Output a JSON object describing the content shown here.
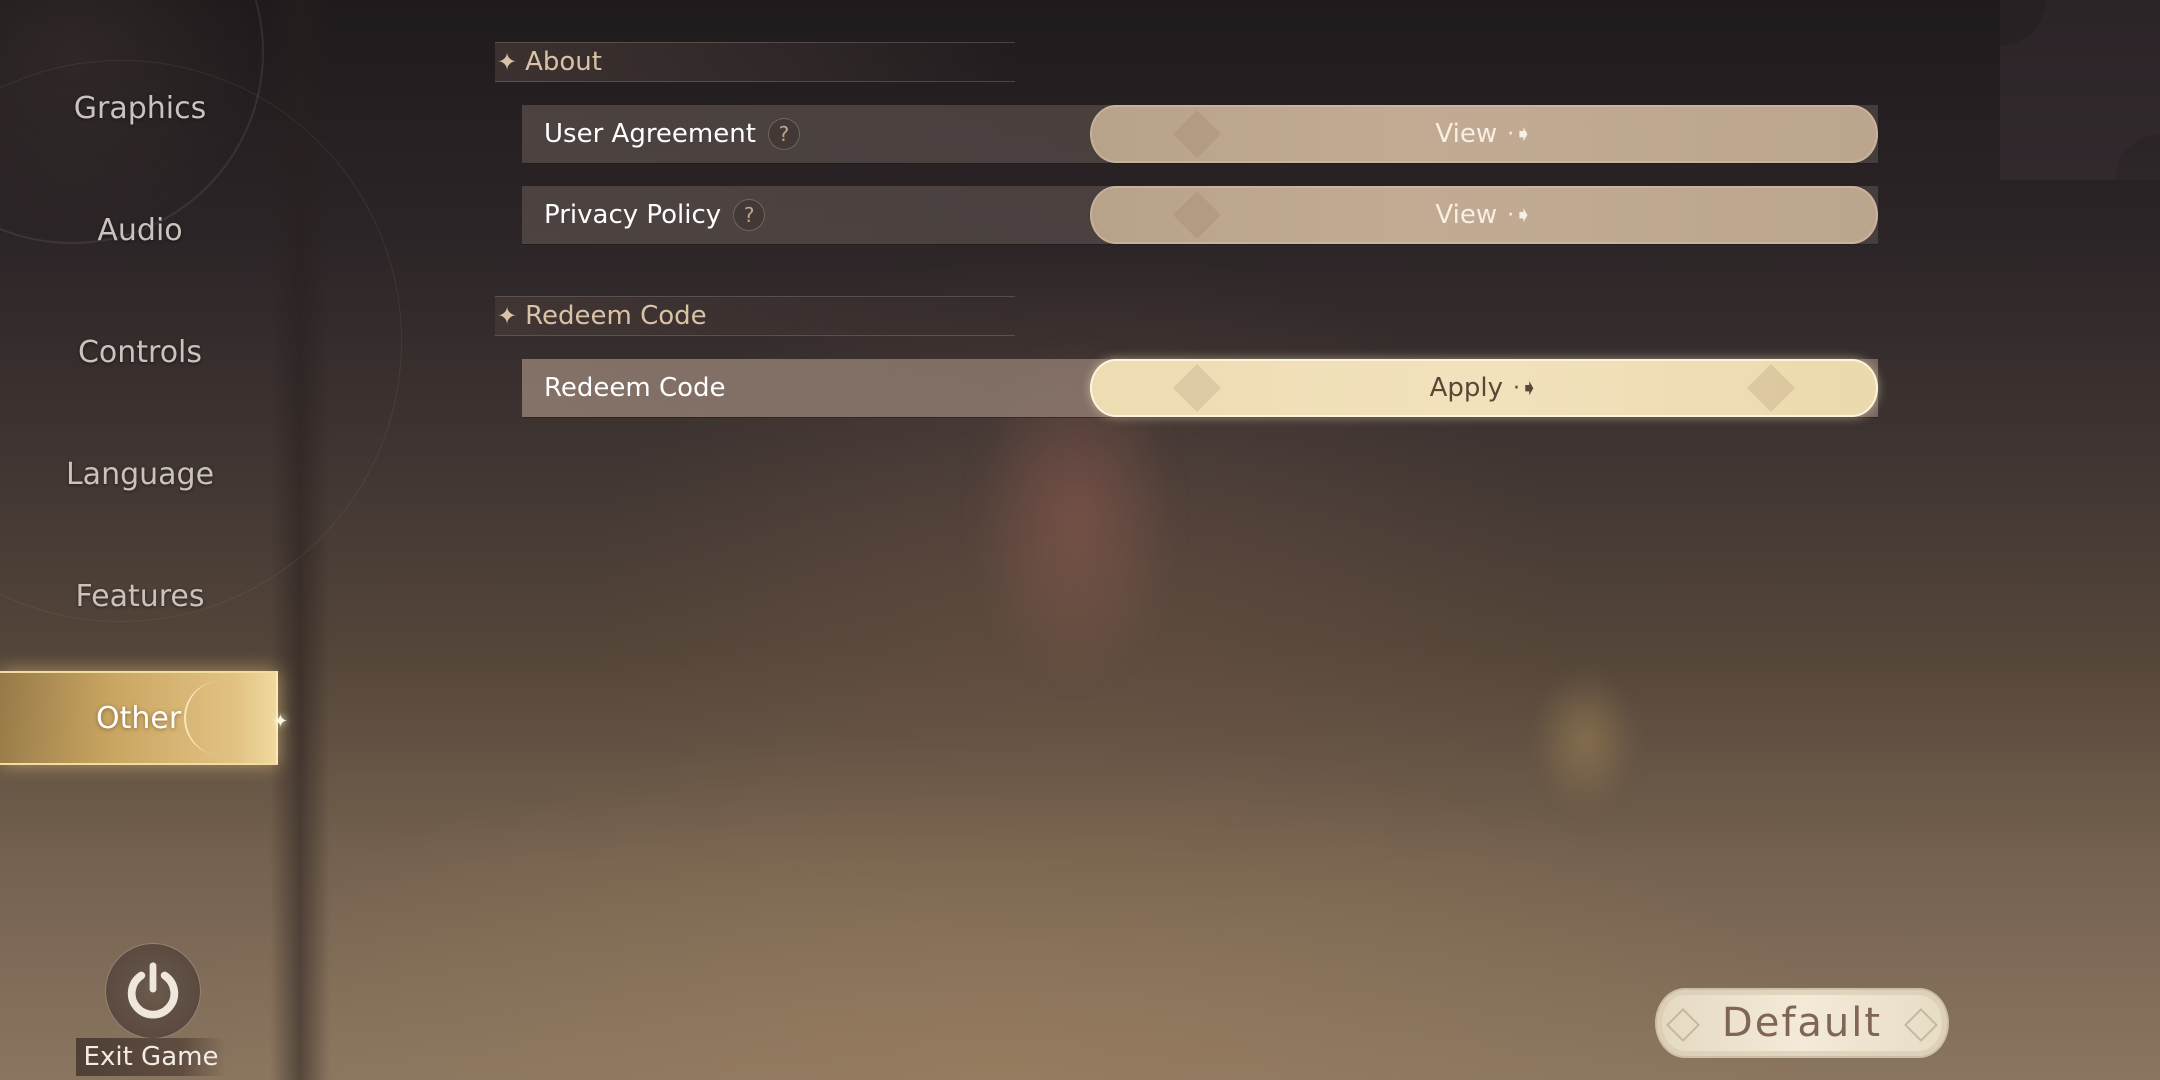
{
  "sidebar": {
    "items": [
      {
        "label": "Graphics",
        "active": false
      },
      {
        "label": "Audio",
        "active": false
      },
      {
        "label": "Controls",
        "active": false
      },
      {
        "label": "Language",
        "active": false
      },
      {
        "label": "Features",
        "active": false
      },
      {
        "label": "Other",
        "active": true
      }
    ],
    "exit_label": "Exit Game",
    "exit_icon": "power-icon"
  },
  "sections": [
    {
      "title": "About",
      "icon": "sparkle-star-icon",
      "rows": [
        {
          "label": "User Agreement",
          "help_icon": "?",
          "button": "View",
          "button_icon": "arrow-right-icon"
        },
        {
          "label": "Privacy Policy",
          "help_icon": "?",
          "button": "View",
          "button_icon": "arrow-right-icon"
        }
      ]
    },
    {
      "title": "Redeem Code",
      "icon": "sparkle-star-icon",
      "rows": [
        {
          "label": "Redeem Code",
          "button": "Apply",
          "button_icon": "arrow-right-icon"
        }
      ]
    }
  ],
  "footer": {
    "default_label": "Default"
  },
  "glyphs": {
    "star": "✦",
    "arrow": "·➧",
    "glint": "✦"
  },
  "colors": {
    "active_tab": "#e2c283",
    "apply_button": "#f2e2bc",
    "view_button": "#c2ab92",
    "default_text": "#806654"
  }
}
